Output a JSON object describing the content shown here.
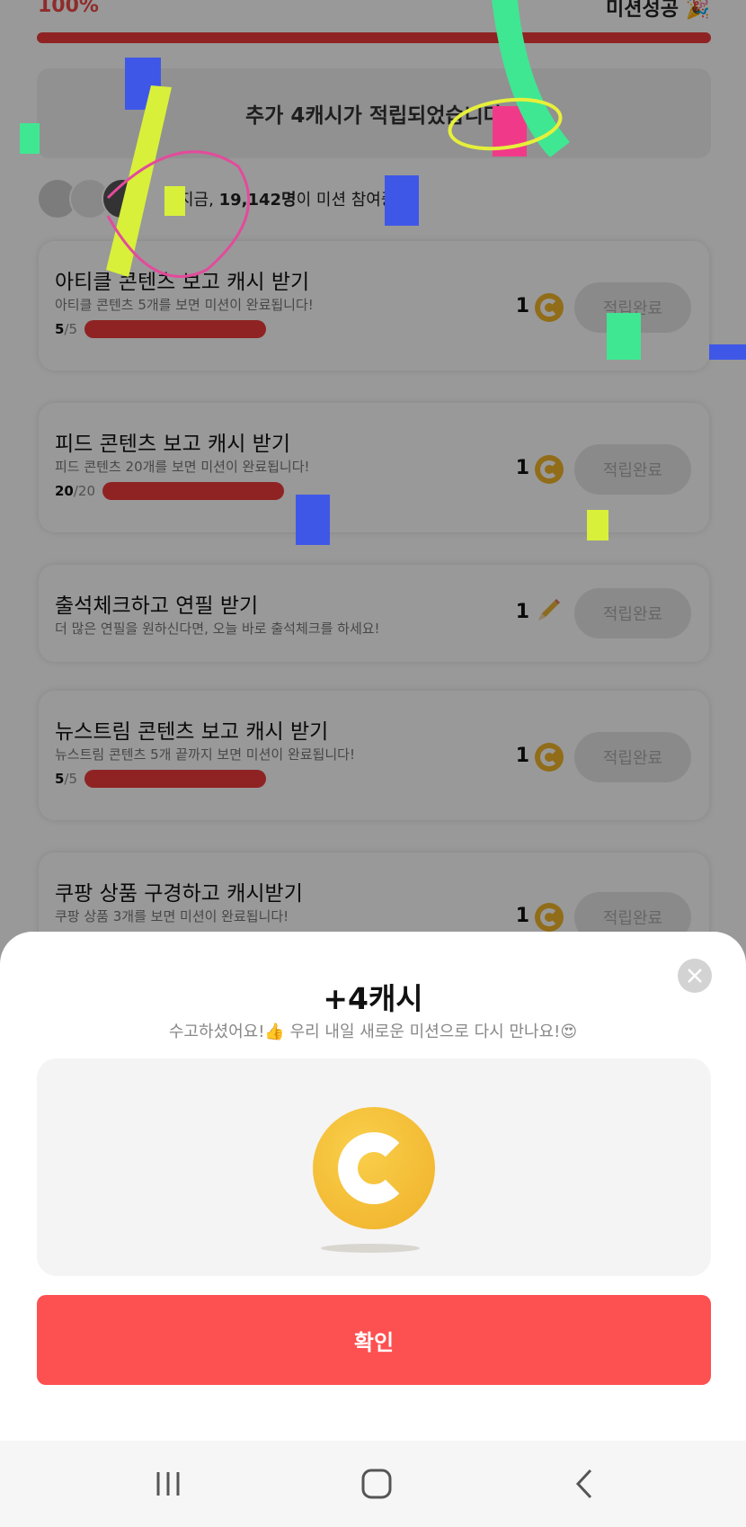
{
  "header": {
    "progress_text": "100%",
    "mission_title": "미션성공 🎉",
    "progress": 1.0
  },
  "banner": {
    "text": "추가 4캐시가 적립되었습니다"
  },
  "participants": {
    "prefix": "지금, ",
    "count": "19,142명",
    "suffix": "이 미션 참여중!"
  },
  "missions": [
    {
      "title": "아티클 콘텐츠 보고 캐시 받기",
      "desc": "아티클 콘텐츠 5개를 보면 미션이 완료됩니다!",
      "progress_num": "5",
      "progress_den": "/5",
      "reward": "1",
      "reward_icon": "coin-icon",
      "button": "적립완료"
    },
    {
      "title": "피드 콘텐츠 보고 캐시 받기",
      "desc": "피드 콘텐츠 20개를 보면 미션이 완료됩니다!",
      "progress_num": "20",
      "progress_den": "/20",
      "reward": "1",
      "reward_icon": "coin-icon",
      "button": "적립완료"
    },
    {
      "title": "출석체크하고 연필 받기",
      "desc": "더 많은 연필을 원하신다면, 오늘 바로 출석체크를 하세요!",
      "reward": "1",
      "reward_icon": "pencil-icon",
      "button": "적립완료"
    },
    {
      "title": "뉴스트림 콘텐츠 보고 캐시 받기",
      "desc": "뉴스트림 콘텐츠 5개 끝까지 보면 미션이 완료됩니다!",
      "progress_num": "5",
      "progress_den": "/5",
      "reward": "1",
      "reward_icon": "coin-icon",
      "button": "적립완료"
    },
    {
      "title": "쿠팡 상품 구경하고 캐시받기",
      "desc": "쿠팡 상품 3개를 보면 미션이 완료됩니다!",
      "reward": "1",
      "reward_icon": "coin-icon",
      "button": "적립완료"
    }
  ],
  "modal": {
    "title": "+4캐시",
    "subtitle": "수고하셨어요!👍 우리 내일 새로운 미션으로 다시 만나요!😍",
    "confirm_label": "확인"
  },
  "navbar": {
    "recent_icon": "recent-apps-icon",
    "home_icon": "home-icon",
    "back_icon": "back-icon"
  },
  "colors": {
    "accent": "#fd5050",
    "progress": "#ef3b3b",
    "coin": "#f2b62a"
  }
}
